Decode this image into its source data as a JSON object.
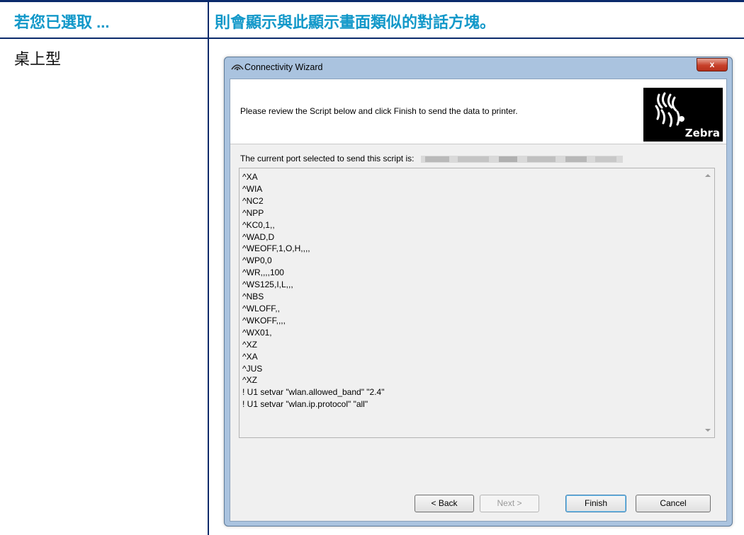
{
  "table": {
    "header_left": "若您已選取 ...",
    "header_right": "則會顯示與此顯示畫面類似的對話方塊。",
    "row_label": "桌上型"
  },
  "dialog": {
    "title": "Connectivity Wizard",
    "close_label": "x",
    "instruction": "Please review the Script below and click Finish to send the data to printer.",
    "logo_text": "Zebra",
    "port_label": "The current port selected to send this script is:",
    "script_lines": [
      "^XA",
      "^WIA",
      "^NC2",
      "^NPP",
      "^KC0,1,,",
      "^WAD,D",
      "^WEOFF,1,O,H,,,,",
      "^WP0,0",
      "^WR,,,,100",
      "^WS125,I,L,,,",
      "^NBS",
      "^WLOFF,,",
      "^WKOFF,,,,",
      "^WX01,",
      "^XZ",
      "^XA",
      "^JUS",
      "^XZ",
      "! U1 setvar \"wlan.allowed_band\" \"2.4\"",
      "! U1 setvar \"wlan.ip.protocol\" \"all\""
    ],
    "buttons": {
      "back": "< Back",
      "next": "Next >",
      "finish": "Finish",
      "cancel": "Cancel"
    }
  },
  "colors": {
    "header_text": "#1298c9",
    "rule": "#0b2a6b",
    "window_frame": "#aac3df"
  }
}
